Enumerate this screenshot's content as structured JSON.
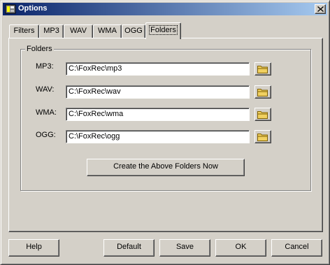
{
  "window": {
    "title": "Options"
  },
  "tabs": [
    {
      "label": "Filters",
      "active": false
    },
    {
      "label": "MP3",
      "active": false
    },
    {
      "label": "WAV",
      "active": false
    },
    {
      "label": "WMA",
      "active": false
    },
    {
      "label": "OGG",
      "active": false
    },
    {
      "label": "Folders",
      "active": true
    }
  ],
  "folders": {
    "group_label": "Folders",
    "rows": [
      {
        "label": "MP3:",
        "value": "C:\\FoxRec\\mp3"
      },
      {
        "label": "WAV:",
        "value": "C:\\FoxRec\\wav"
      },
      {
        "label": "WMA:",
        "value": "C:\\FoxRec\\wma"
      },
      {
        "label": "OGG:",
        "value": "C:\\FoxRec\\ogg"
      }
    ],
    "create_button": "Create the Above Folders Now"
  },
  "buttons": {
    "help": "Help",
    "default": "Default",
    "save": "Save",
    "ok": "OK",
    "cancel": "Cancel"
  },
  "icons": {
    "app": "app-icon",
    "close": "close-icon",
    "browse": "folder-icon"
  },
  "colors": {
    "titlebar_start": "#0a246a",
    "titlebar_end": "#a6caf0",
    "face": "#d4d0c8",
    "folder": "#f0d060"
  }
}
